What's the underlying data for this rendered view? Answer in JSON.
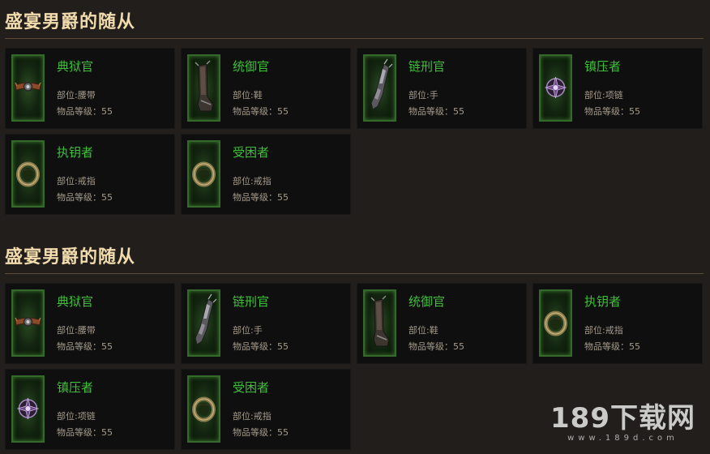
{
  "sections": [
    {
      "title": "盛宴男爵的随从",
      "items": [
        {
          "name": "典狱官",
          "slot": "部位:腰带",
          "level": "物品等级：55",
          "icon": "belt-icon"
        },
        {
          "name": "统御官",
          "slot": "部位:鞋",
          "level": "物品等级：55",
          "icon": "boots-icon"
        },
        {
          "name": "链刑官",
          "slot": "部位:手",
          "level": "物品等级：55",
          "icon": "gauntlet-icon"
        },
        {
          "name": "镇压者",
          "slot": "部位:项链",
          "level": "物品等级：55",
          "icon": "amulet-icon"
        },
        {
          "name": "执钥者",
          "slot": "部位:戒指",
          "level": "物品等级：55",
          "icon": "ring-icon"
        },
        {
          "name": "受困者",
          "slot": "部位:戒指",
          "level": "物品等级：55",
          "icon": "ring-icon"
        }
      ]
    },
    {
      "title": "盛宴男爵的随从",
      "items": [
        {
          "name": "典狱官",
          "slot": "部位:腰带",
          "level": "物品等级：55",
          "icon": "belt-icon"
        },
        {
          "name": "链刑官",
          "slot": "部位:手",
          "level": "物品等级：55",
          "icon": "gauntlet-icon"
        },
        {
          "name": "统御官",
          "slot": "部位:鞋",
          "level": "物品等级：55",
          "icon": "boots-icon"
        },
        {
          "name": "执钥者",
          "slot": "部位:戒指",
          "level": "物品等级：55",
          "icon": "ring-icon"
        },
        {
          "name": "镇压者",
          "slot": "部位:项链",
          "level": "物品等级：55",
          "icon": "amulet-icon"
        },
        {
          "name": "受困者",
          "slot": "部位:戒指",
          "level": "物品等级：55",
          "icon": "ring-icon"
        }
      ]
    }
  ],
  "watermark": {
    "main": "189下载网",
    "sub": "www.189d.com"
  },
  "colors": {
    "background": "#221e1b",
    "title": "#f2dcae",
    "item_name": "#3fbf3a",
    "card": "#0f0f0f",
    "slot_border": "#34692b"
  }
}
